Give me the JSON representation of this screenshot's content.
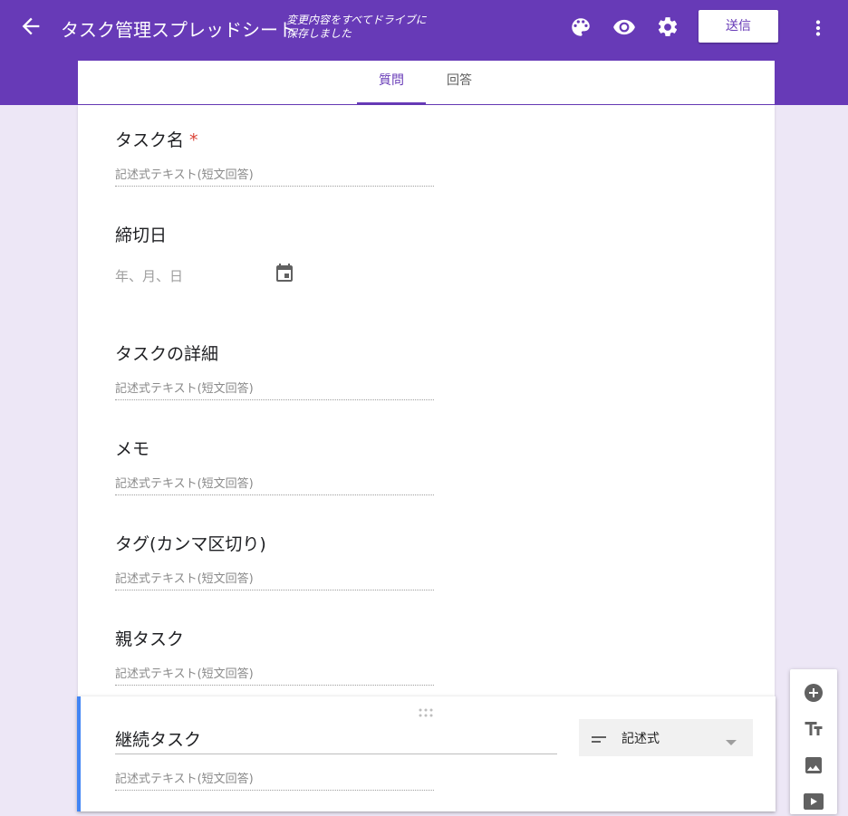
{
  "header": {
    "title": "タスク管理スプレッドシート",
    "save_status": "変更内容をすべてドライブに保存しました",
    "send_label": "送信",
    "icons": [
      "back-arrow-icon",
      "palette-icon",
      "eye-icon",
      "gear-icon",
      "more-vert-icon"
    ],
    "colors": {
      "brand": "#673ab7",
      "background": "#ede7f6",
      "accent": "#4285f4",
      "required": "#db4437"
    }
  },
  "tabs": [
    {
      "label": "質問",
      "active": true
    },
    {
      "label": "回答",
      "active": false
    }
  ],
  "questions": [
    {
      "title": "タスク名",
      "required_mark": "*",
      "answer_placeholder": "記述式テキスト(短文回答)"
    },
    {
      "title": "締切日",
      "date_placeholder": "年、月、日"
    },
    {
      "title": "タスクの詳細",
      "answer_placeholder": "記述式テキスト(短文回答)"
    },
    {
      "title": "メモ",
      "answer_placeholder": "記述式テキスト(短文回答)"
    },
    {
      "title": "タグ(カンマ区切り)",
      "answer_placeholder": "記述式テキスト(短文回答)"
    },
    {
      "title": "親タスク",
      "answer_placeholder": "記述式テキスト(短文回答)"
    }
  ],
  "active_question": {
    "title": "継続タスク",
    "answer_placeholder": "記述式テキスト(短文回答)",
    "type_label": "記述式"
  },
  "side_toolbar": [
    "add-question-icon",
    "title-text-icon",
    "image-icon",
    "video-icon"
  ]
}
